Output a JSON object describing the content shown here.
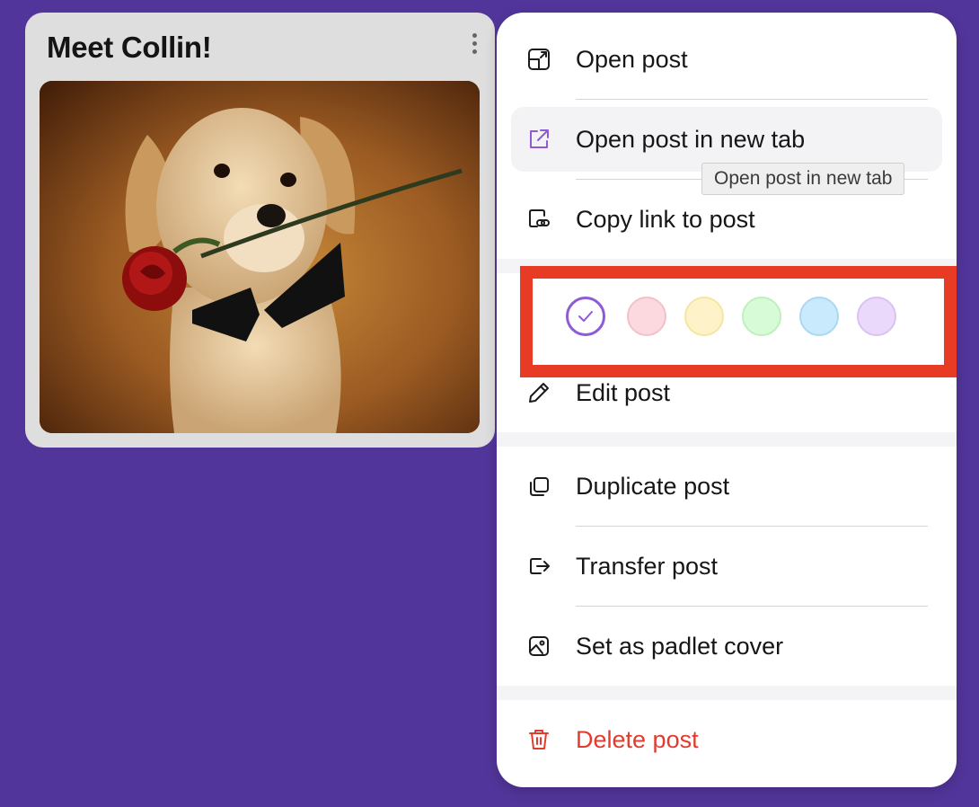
{
  "card": {
    "title": "Meet Collin!",
    "more_icon": "vertical-ellipsis-icon",
    "image_alt": "golden retriever puppy with a bow tie holding a red rose"
  },
  "menu": {
    "items": [
      {
        "label": "Open post",
        "icon": "open-icon"
      },
      {
        "label": "Open post in new tab",
        "icon": "external-link-icon",
        "hovered": true
      },
      {
        "label": "Copy link to post",
        "icon": "copy-link-icon"
      },
      {
        "label": "Edit post",
        "icon": "pencil-icon"
      },
      {
        "label": "Duplicate post",
        "icon": "duplicate-icon"
      },
      {
        "label": "Transfer post",
        "icon": "transfer-icon"
      },
      {
        "label": "Set as padlet cover",
        "icon": "image-cover-icon"
      },
      {
        "label": "Delete post",
        "icon": "trash-icon",
        "color": "#e23b2e"
      }
    ],
    "tooltip": "Open post in new tab",
    "colors": [
      {
        "name": "default",
        "fill": "#ffffff",
        "border": "#8e5ad8",
        "selected": true
      },
      {
        "name": "red",
        "fill": "#fbd9de",
        "border": "#f3c2c8"
      },
      {
        "name": "yellow",
        "fill": "#fef3c8",
        "border": "#f7e5a2"
      },
      {
        "name": "green",
        "fill": "#d7fbd6",
        "border": "#bff0bd"
      },
      {
        "name": "blue",
        "fill": "#c9e9fc",
        "border": "#a9d9f5"
      },
      {
        "name": "purple",
        "fill": "#ead9fb",
        "border": "#d9c2f4"
      }
    ],
    "highlight_color": "#e73b26",
    "accent_color": "#8e5ad8"
  },
  "background_color": "#52359a"
}
